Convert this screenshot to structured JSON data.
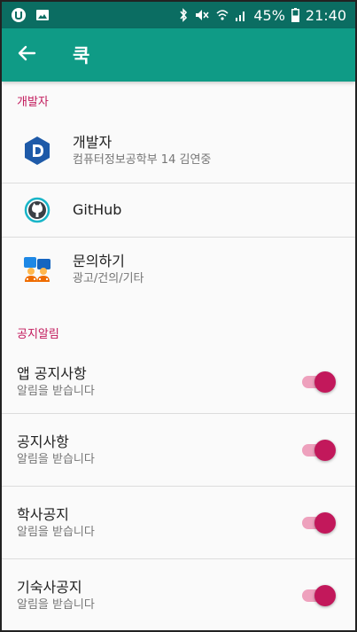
{
  "status_bar": {
    "left_icons": [
      "app-notification-icon",
      "image-icon"
    ],
    "right_icons": [
      "bluetooth-icon",
      "mute-icon",
      "wifi-icon",
      "signal-icon"
    ],
    "battery_percent": "45%",
    "time": "21:40"
  },
  "app_bar": {
    "back_icon": "arrow-back-icon",
    "title": "쿡"
  },
  "colors": {
    "status_bar": "#0b6d62",
    "app_bar": "#0f9b86",
    "accent": "#c2185b",
    "switch_track": "#eea1bd"
  },
  "sections": [
    {
      "header": "개발자",
      "items": [
        {
          "icon": "developer-logo-icon",
          "title": "개발자",
          "subtitle": "컴퓨터정보공학부 14 김연중"
        },
        {
          "icon": "github-icon",
          "title": "GitHub"
        },
        {
          "icon": "contact-people-icon",
          "title": "문의하기",
          "subtitle": "광고/건의/기타"
        }
      ]
    },
    {
      "header": "공지알림",
      "items": [
        {
          "title": "앱 공지사항",
          "subtitle": "알림을 받습니다",
          "enabled": true
        },
        {
          "title": "공지사항",
          "subtitle": "알림을 받습니다",
          "enabled": true
        },
        {
          "title": "학사공지",
          "subtitle": "알림을 받습니다",
          "enabled": true
        },
        {
          "title": "기숙사공지",
          "subtitle": "알림을 받습니다",
          "enabled": true
        }
      ]
    }
  ]
}
